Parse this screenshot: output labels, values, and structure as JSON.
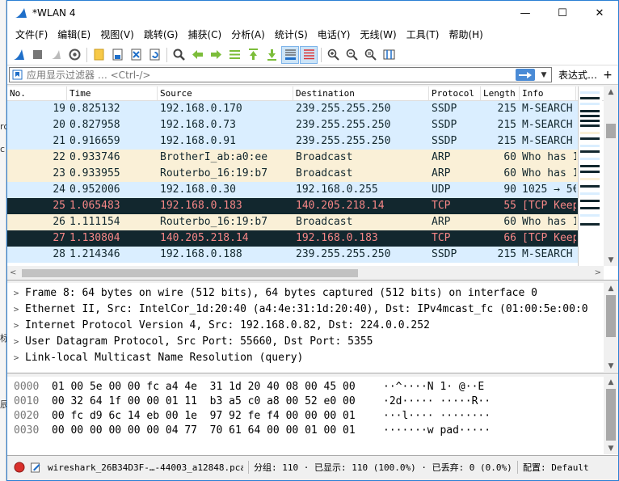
{
  "desktop": {
    "chars": [
      "rd",
      "c",
      "标",
      "辰"
    ]
  },
  "window": {
    "title": "*WLAN 4",
    "controls": {
      "minimize": "—",
      "maximize": "☐",
      "close": "✕"
    }
  },
  "menu": [
    "文件(F)",
    "编辑(E)",
    "视图(V)",
    "跳转(G)",
    "捕获(C)",
    "分析(A)",
    "统计(S)",
    "电话(Y)",
    "无线(W)",
    "工具(T)",
    "帮助(H)"
  ],
  "filter": {
    "placeholder": "应用显示过滤器 … <Ctrl-/>",
    "expression_label": "表达式…",
    "plus_label": "+"
  },
  "packet_list": {
    "columns": [
      "No.",
      "Time",
      "Source",
      "Destination",
      "Protocol",
      "Length",
      "Info"
    ],
    "rows": [
      {
        "no": "19",
        "time": "0.825132",
        "src": "192.168.0.170",
        "dst": "239.255.255.250",
        "proto": "SSDP",
        "len": "215",
        "info": "M-SEARCH",
        "kind": "udp"
      },
      {
        "no": "20",
        "time": "0.827958",
        "src": "192.168.0.73",
        "dst": "239.255.255.250",
        "proto": "SSDP",
        "len": "215",
        "info": "M-SEARCH",
        "kind": "udp"
      },
      {
        "no": "21",
        "time": "0.916659",
        "src": "192.168.0.91",
        "dst": "239.255.255.250",
        "proto": "SSDP",
        "len": "215",
        "info": "M-SEARCH",
        "kind": "udp"
      },
      {
        "no": "22",
        "time": "0.933746",
        "src": "BrotherI_ab:a0:ee",
        "dst": "Broadcast",
        "proto": "ARP",
        "len": "60",
        "info": "Who has 1",
        "kind": "arp"
      },
      {
        "no": "23",
        "time": "0.933955",
        "src": "Routerbo_16:19:b7",
        "dst": "Broadcast",
        "proto": "ARP",
        "len": "60",
        "info": "Who has 1",
        "kind": "arp"
      },
      {
        "no": "24",
        "time": "0.952006",
        "src": "192.168.0.30",
        "dst": "192.168.0.255",
        "proto": "UDP",
        "len": "90",
        "info": "1025 → 5€",
        "kind": "udp"
      },
      {
        "no": "25",
        "time": "1.065483",
        "src": "192.168.0.183",
        "dst": "140.205.218.14",
        "proto": "TCP",
        "len": "55",
        "info": "[TCP Keep",
        "kind": "tcpbad"
      },
      {
        "no": "26",
        "time": "1.111154",
        "src": "Routerbo_16:19:b7",
        "dst": "Broadcast",
        "proto": "ARP",
        "len": "60",
        "info": "Who has 1",
        "kind": "arp"
      },
      {
        "no": "27",
        "time": "1.130804",
        "src": "140.205.218.14",
        "dst": "192.168.0.183",
        "proto": "TCP",
        "len": "66",
        "info": "[TCP Keep",
        "kind": "tcpbad"
      },
      {
        "no": "28",
        "time": "1.214346",
        "src": "192.168.0.188",
        "dst": "239.255.255.250",
        "proto": "SSDP",
        "len": "215",
        "info": "M-SEARCH",
        "kind": "udp"
      }
    ]
  },
  "details": [
    {
      "chevron": ">",
      "text": "Frame 8: 64 bytes on wire (512 bits), 64 bytes captured (512 bits) on interface 0"
    },
    {
      "chevron": ">",
      "text": "Ethernet II, Src: IntelCor_1d:20:40 (a4:4e:31:1d:20:40), Dst: IPv4mcast_fc (01:00:5e:00:0"
    },
    {
      "chevron": ">",
      "text": "Internet Protocol Version 4, Src: 192.168.0.82, Dst: 224.0.0.252"
    },
    {
      "chevron": ">",
      "text": "User Datagram Protocol, Src Port: 55660, Dst Port: 5355"
    },
    {
      "chevron": ">",
      "text": "Link-local Multicast Name Resolution (query)"
    }
  ],
  "bytes": [
    {
      "offset": "0000",
      "hex": "01 00 5e 00 00 fc a4 4e  31 1d 20 40 08 00 45 00",
      "ascii": "··^····N 1· @··E"
    },
    {
      "offset": "0010",
      "hex": "00 32 64 1f 00 00 01 11  b3 a5 c0 a8 00 52 e0 00",
      "ascii": "·2d····· ·····R··"
    },
    {
      "offset": "0020",
      "hex": "00 fc d9 6c 14 eb 00 1e  97 92 fe f4 00 00 00 01",
      "ascii": "···l···· ········"
    },
    {
      "offset": "0030",
      "hex": "00 00 00 00 00 00 04 77  70 61 64 00 00 01 00 01",
      "ascii": "·······w pad·····"
    }
  ],
  "status": {
    "file": "wireshark_26B34D3F-…-44003_a12848.pcapng",
    "stats": "分组: 110 · 已显示: 110 (100.0%) · 已丢弃: 0 (0.0%)",
    "profile": "配置: Default"
  },
  "colors": {
    "udp": "#daeeff",
    "arp": "#faf0d7",
    "tcp_bad_bg": "#12272e",
    "tcp_bad_fg": "#f78787",
    "accent": "#1f6fc9"
  }
}
